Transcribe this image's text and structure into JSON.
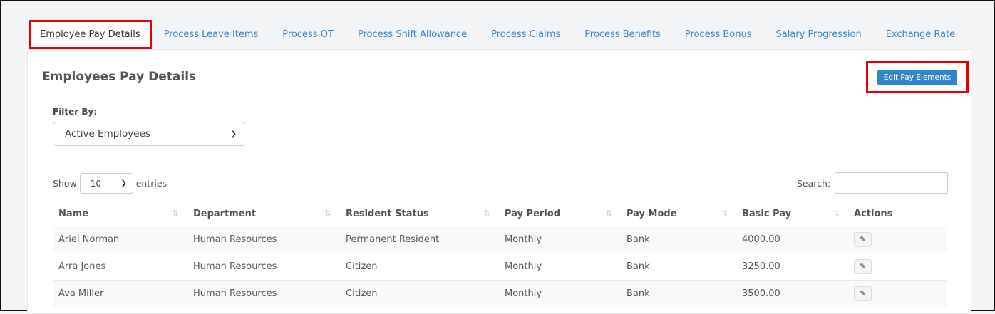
{
  "tabs": [
    {
      "label": "Employee Pay Details",
      "active": true
    },
    {
      "label": "Process Leave Items"
    },
    {
      "label": "Process OT"
    },
    {
      "label": "Process Shift Allowance"
    },
    {
      "label": "Process Claims"
    },
    {
      "label": "Process Benefits"
    },
    {
      "label": "Process Bonus"
    },
    {
      "label": "Salary Progression"
    },
    {
      "label": "Exchange Rate"
    }
  ],
  "page": {
    "title": "Employees Pay Details",
    "edit_button": "Edit Pay Elements"
  },
  "filter": {
    "label": "Filter By:",
    "selected": "Active Employees"
  },
  "length": {
    "prefix": "Show",
    "value": "10",
    "suffix": "entries"
  },
  "search": {
    "label": "Search:",
    "value": ""
  },
  "table": {
    "columns": [
      "Name",
      "Department",
      "Resident Status",
      "Pay Period",
      "Pay Mode",
      "Basic Pay",
      "Actions"
    ],
    "rows": [
      [
        "Ariel Norman",
        "Human Resources",
        "Permanent Resident",
        "Monthly",
        "Bank",
        "4000.00"
      ],
      [
        "Arra Jones",
        "Human Resources",
        "Citizen",
        "Monthly",
        "Bank",
        "3250.00"
      ],
      [
        "Ava Miller",
        "Human Resources",
        "Citizen",
        "Monthly",
        "Bank",
        "3500.00"
      ]
    ]
  },
  "icons": {
    "sort": "sort-arrows-icon",
    "edit": "pencil-icon",
    "dropdown": "chevron-down-icon"
  },
  "colors": {
    "link": "#3a86c8",
    "primary_button": "#2f86c9",
    "highlight": "#e60000"
  }
}
